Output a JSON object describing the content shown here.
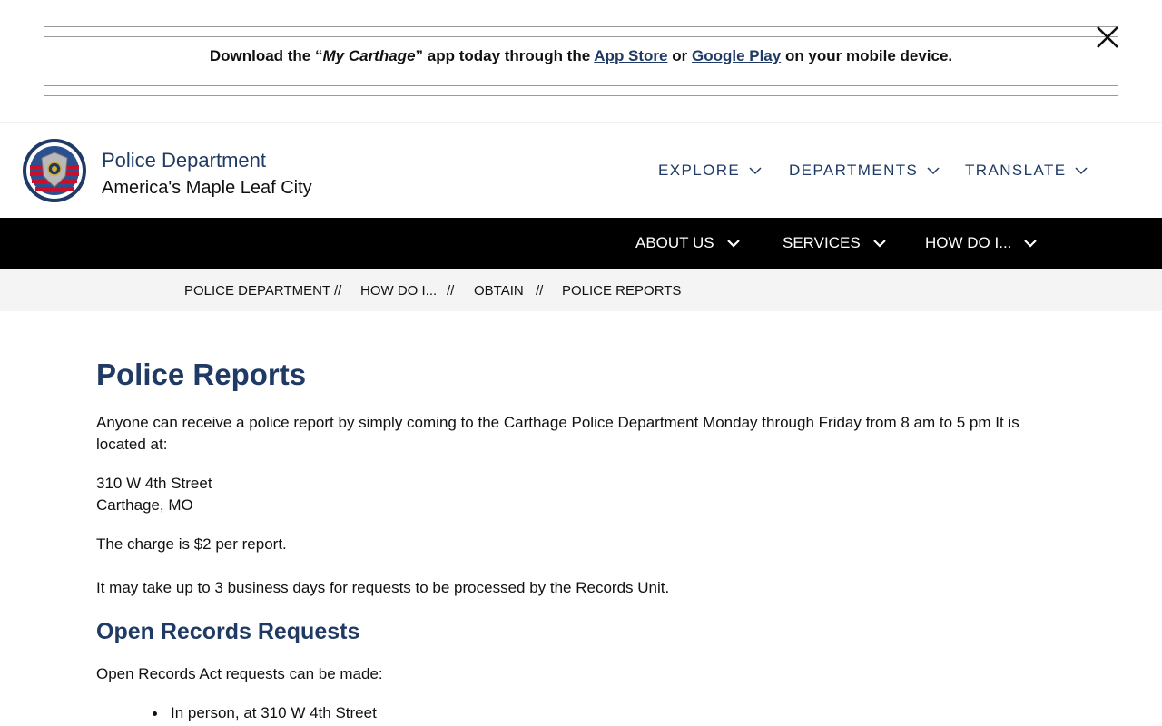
{
  "banner": {
    "text_before": "Download the “",
    "app_name": "My Carthage",
    "text_mid": "” app today through the ",
    "app_store_label": "App Store",
    "or_text": " or ",
    "google_play_label": "Google Play",
    "text_after": " on your mobile device.",
    "close_icon": "close-icon"
  },
  "header": {
    "seal_icon": "police-seal-logo",
    "dept_name": "Police Department",
    "tagline": "America's Maple Leaf City",
    "top_nav": [
      {
        "label": "EXPLORE",
        "icon": "chevron-down-icon"
      },
      {
        "label": "DEPARTMENTS",
        "icon": "chevron-down-icon"
      },
      {
        "label": "TRANSLATE",
        "icon": "chevron-down-icon"
      }
    ]
  },
  "main_nav": [
    {
      "label": "ABOUT US",
      "icon": "chevron-down-icon"
    },
    {
      "label": "SERVICES",
      "icon": "chevron-down-icon"
    },
    {
      "label": "HOW DO I...",
      "icon": "chevron-down-icon"
    }
  ],
  "breadcrumb": {
    "items": [
      "POLICE DEPARTMENT",
      "HOW DO I...",
      "OBTAIN",
      "POLICE REPORTS"
    ],
    "separator": "//"
  },
  "content": {
    "title": "Police Reports",
    "intro": "Anyone can receive a police report by simply coming to the Carthage Police Department Monday through Friday from 8 am to 5 pm It is located at:",
    "address_line1": "310 W 4th Street",
    "address_line2": "Carthage, MO",
    "charge": "The charge is $2 per report.",
    "processing": "It may take up to 3 business days for requests to be processed by the Records Unit.",
    "open_records_heading": "Open Records Requests",
    "open_records_intro": "Open Records Act requests can be made:",
    "open_records_items": [
      "In person, at 310 W 4th Street"
    ]
  },
  "colors": {
    "navy": "#1f3a64",
    "nav_bg": "#000000",
    "breadcrumb_bg": "#f4f4f4"
  }
}
